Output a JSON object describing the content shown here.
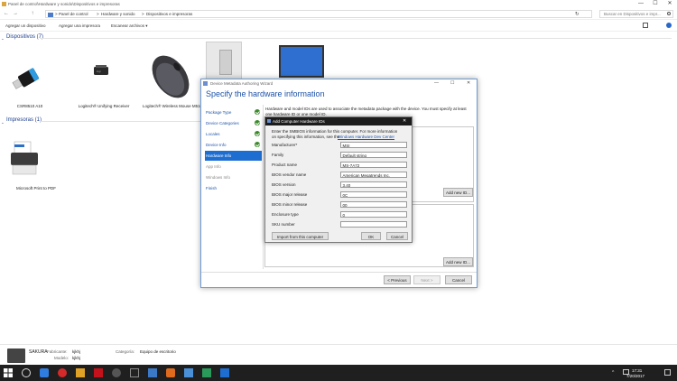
{
  "window": {
    "title": "Panel de control\\Hardware y sonido\\Dispositivos e impresoras",
    "minimize": "—",
    "maximize": "☐",
    "close": "✕"
  },
  "address": {
    "back": "←",
    "forward": "→",
    "up": "↑",
    "crumbs": [
      "Panel de control",
      "Hardware y sonido",
      "Dispositivos e impresoras"
    ],
    "separator": ">",
    "refresh": "↻",
    "search_placeholder": "Buscar en Dispositivos e impr..."
  },
  "commands": {
    "add_device": "Agregar un dispositivo",
    "add_printer": "Agregar una impresora",
    "scan": "Escanear archivos ▾"
  },
  "groups": {
    "devices": "Dispositivos (7)",
    "printers": "Impresoras (1)"
  },
  "devices": [
    {
      "label": "CSR8510 A10"
    },
    {
      "label": "Logitech® Unifying Receiver"
    },
    {
      "label": "Logitech® Wireless Mouse M510"
    }
  ],
  "printers": [
    {
      "label": "Microsoft Print to PDF"
    }
  ],
  "details": {
    "name": "SAKURA",
    "fabricante_label": "Fabricante:",
    "fabricante": "kjkhj",
    "modelo_label": "Modelo:",
    "modelo": "kjkhj",
    "categoria_label": "Categoría:",
    "categoria": "Equipo de escritorio"
  },
  "taskbar": {
    "time": "17:31",
    "date": "7/20/2017"
  },
  "wizard": {
    "title": "Device Metadata Authoring Wizard",
    "heading": "Specify the hardware information",
    "description_1": "Hardware and model IDs are used to associate the metadata package with the device. You must specify at least",
    "description_2": "one hardware ID or one model ID.",
    "steps": [
      {
        "label": "Package Type",
        "state": "done"
      },
      {
        "label": "Device Categories",
        "state": "done"
      },
      {
        "label": "Locales",
        "state": "done"
      },
      {
        "label": "Device Info",
        "state": "done"
      },
      {
        "label": "Hardware Info",
        "state": "active"
      },
      {
        "label": "App Info",
        "state": "disabled"
      },
      {
        "label": "Windows Info",
        "state": "disabled"
      },
      {
        "label": "Finish",
        "state": "pending"
      }
    ],
    "add_new_id_1": "Add new ID...",
    "add_new_id_2": "Add new ID...",
    "previous": "< Previous",
    "next": "Next >",
    "cancel": "Cancel"
  },
  "hw_dialog": {
    "title": "Add Computer Hardware IDs",
    "intro_1": "Enter the SMBIOS information for this computer. For more information",
    "intro_2": "on specifying this information, see the",
    "intro_link": "Windows Hardware Dev Center",
    "fields": [
      {
        "label": "Manufacturer*",
        "value": "MSI"
      },
      {
        "label": "Family",
        "value": "Default string"
      },
      {
        "label": "Product name",
        "value": "MS-7A72"
      },
      {
        "label": "BIOS vendor name",
        "value": "American Megatrends Inc."
      },
      {
        "label": "BIOS version",
        "value": "3.40"
      },
      {
        "label": "BIOS major release",
        "value": "0C"
      },
      {
        "label": "BIOS minor release",
        "value": "00"
      },
      {
        "label": "Enclosure type",
        "value": "0"
      },
      {
        "label": "SKU number",
        "value": ""
      }
    ],
    "import_button": "Import from this computer",
    "ok": "OK",
    "cancel": "Cancel"
  }
}
